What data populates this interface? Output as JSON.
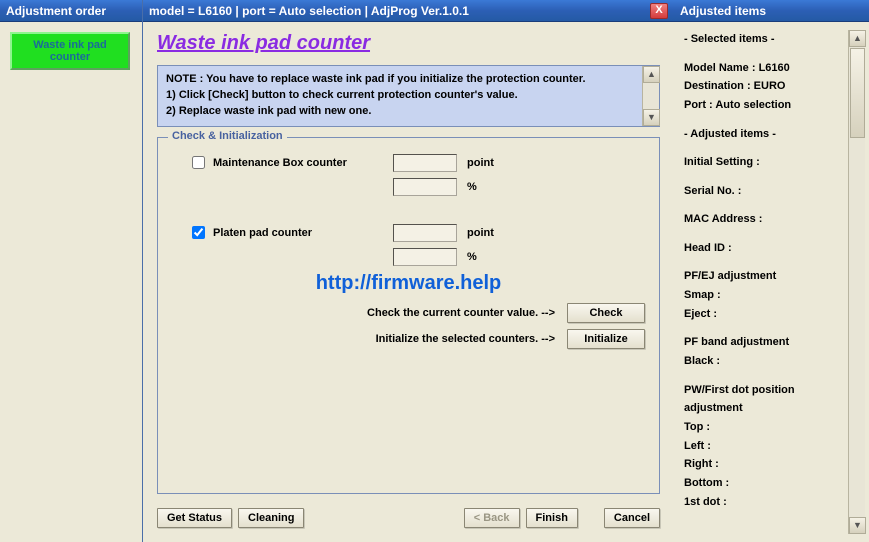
{
  "left": {
    "title": "Adjustment order",
    "button": "Waste ink pad\ncounter"
  },
  "center": {
    "title": "model = L6160 | port = Auto selection | AdjProg Ver.1.0.1",
    "page_title": "Waste ink pad counter",
    "note_l1": "NOTE : You have to replace waste ink pad if you initialize the protection counter.",
    "note_l2": "1) Click [Check] button to check current protection counter's value.",
    "note_l3": "2) Replace waste ink pad with new one.",
    "group_legend": "Check & Initialization",
    "maint_label": "Maintenance Box counter",
    "maint_checked": false,
    "maint_point": "",
    "maint_pct": "",
    "platen_label": "Platen pad counter",
    "platen_checked": true,
    "platen_point": "",
    "platen_pct": "",
    "unit_point": "point",
    "unit_pct": "%",
    "watermark_url": "http://firmware.help",
    "check_hint": "Check the current counter value. -->",
    "init_hint": "Initialize the selected counters. -->",
    "btn_check": "Check",
    "btn_init": "Initialize",
    "btn_get_status": "Get Status",
    "btn_cleaning": "Cleaning",
    "btn_back": "< Back",
    "btn_finish": "Finish",
    "btn_cancel": "Cancel"
  },
  "right": {
    "title": "Adjusted items",
    "lines": [
      "- Selected items -",
      "",
      "Model Name : L6160",
      "Destination : EURO",
      "Port : Auto selection",
      "",
      "- Adjusted items -",
      "",
      "Initial Setting :",
      "",
      "Serial No. :",
      "",
      "MAC Address :",
      "",
      "Head ID :",
      "",
      "PF/EJ adjustment",
      " Smap :",
      " Eject :",
      "",
      "PF band adjustment",
      " Black :",
      "",
      "PW/First dot position adjustment",
      " Top :",
      " Left :",
      " Right :",
      " Bottom :",
      " 1st dot :"
    ]
  },
  "big_watermark": "http://firmware.help"
}
